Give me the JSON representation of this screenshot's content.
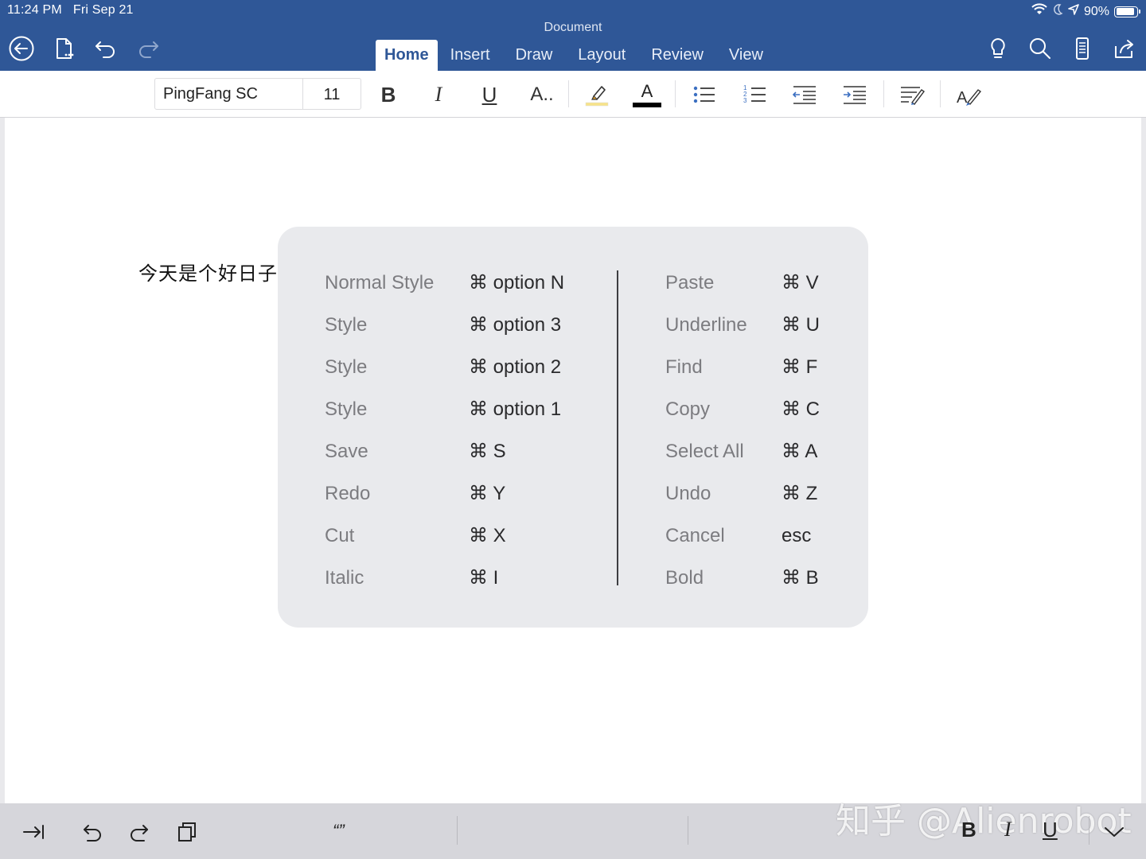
{
  "status_bar": {
    "time": "11:24 PM",
    "date": "Fri Sep 21",
    "battery": "90%"
  },
  "header": {
    "doc_title": "Document",
    "tabs": [
      {
        "label": "Home",
        "active": true
      },
      {
        "label": "Insert",
        "active": false
      },
      {
        "label": "Draw",
        "active": false
      },
      {
        "label": "Layout",
        "active": false
      },
      {
        "label": "Review",
        "active": false
      },
      {
        "label": "View",
        "active": false
      }
    ]
  },
  "ribbon": {
    "font_name": "PingFang SC",
    "font_size": "11",
    "font_style_glyph": "A..",
    "font_color_glyph": "A",
    "highlight_color": "#f7e38a",
    "font_color": "#000000"
  },
  "document": {
    "text": "今天是个好日子"
  },
  "shortcuts": {
    "left": [
      {
        "command": "Normal Style",
        "keys": "⌘ option N"
      },
      {
        "command": "Style",
        "keys": "⌘ option 3"
      },
      {
        "command": "Style",
        "keys": "⌘ option 2"
      },
      {
        "command": "Style",
        "keys": "⌘ option 1"
      },
      {
        "command": "Save",
        "keys": "⌘ S"
      },
      {
        "command": "Redo",
        "keys": "⌘ Y"
      },
      {
        "command": "Cut",
        "keys": "⌘ X"
      },
      {
        "command": "Italic",
        "keys": "⌘ I"
      }
    ],
    "right": [
      {
        "command": "Paste",
        "keys": "⌘ V"
      },
      {
        "command": "Underline",
        "keys": "⌘ U"
      },
      {
        "command": "Find",
        "keys": "⌘ F"
      },
      {
        "command": "Copy",
        "keys": "⌘ C"
      },
      {
        "command": "Select All",
        "keys": "⌘ A"
      },
      {
        "command": "Undo",
        "keys": "⌘ Z"
      },
      {
        "command": "Cancel",
        "keys": "esc"
      },
      {
        "command": "Bold",
        "keys": "⌘ B"
      }
    ]
  },
  "bottom_bar": {
    "quote_glyph": "“”",
    "bold": "B",
    "italic": "I",
    "underline": "U",
    "watermark": "知乎 @Alienrobot"
  },
  "colors": {
    "header_blue": "#2f5797",
    "ribbon_bg": "#ffffff",
    "overlay_bg": "#e8e9ec"
  }
}
